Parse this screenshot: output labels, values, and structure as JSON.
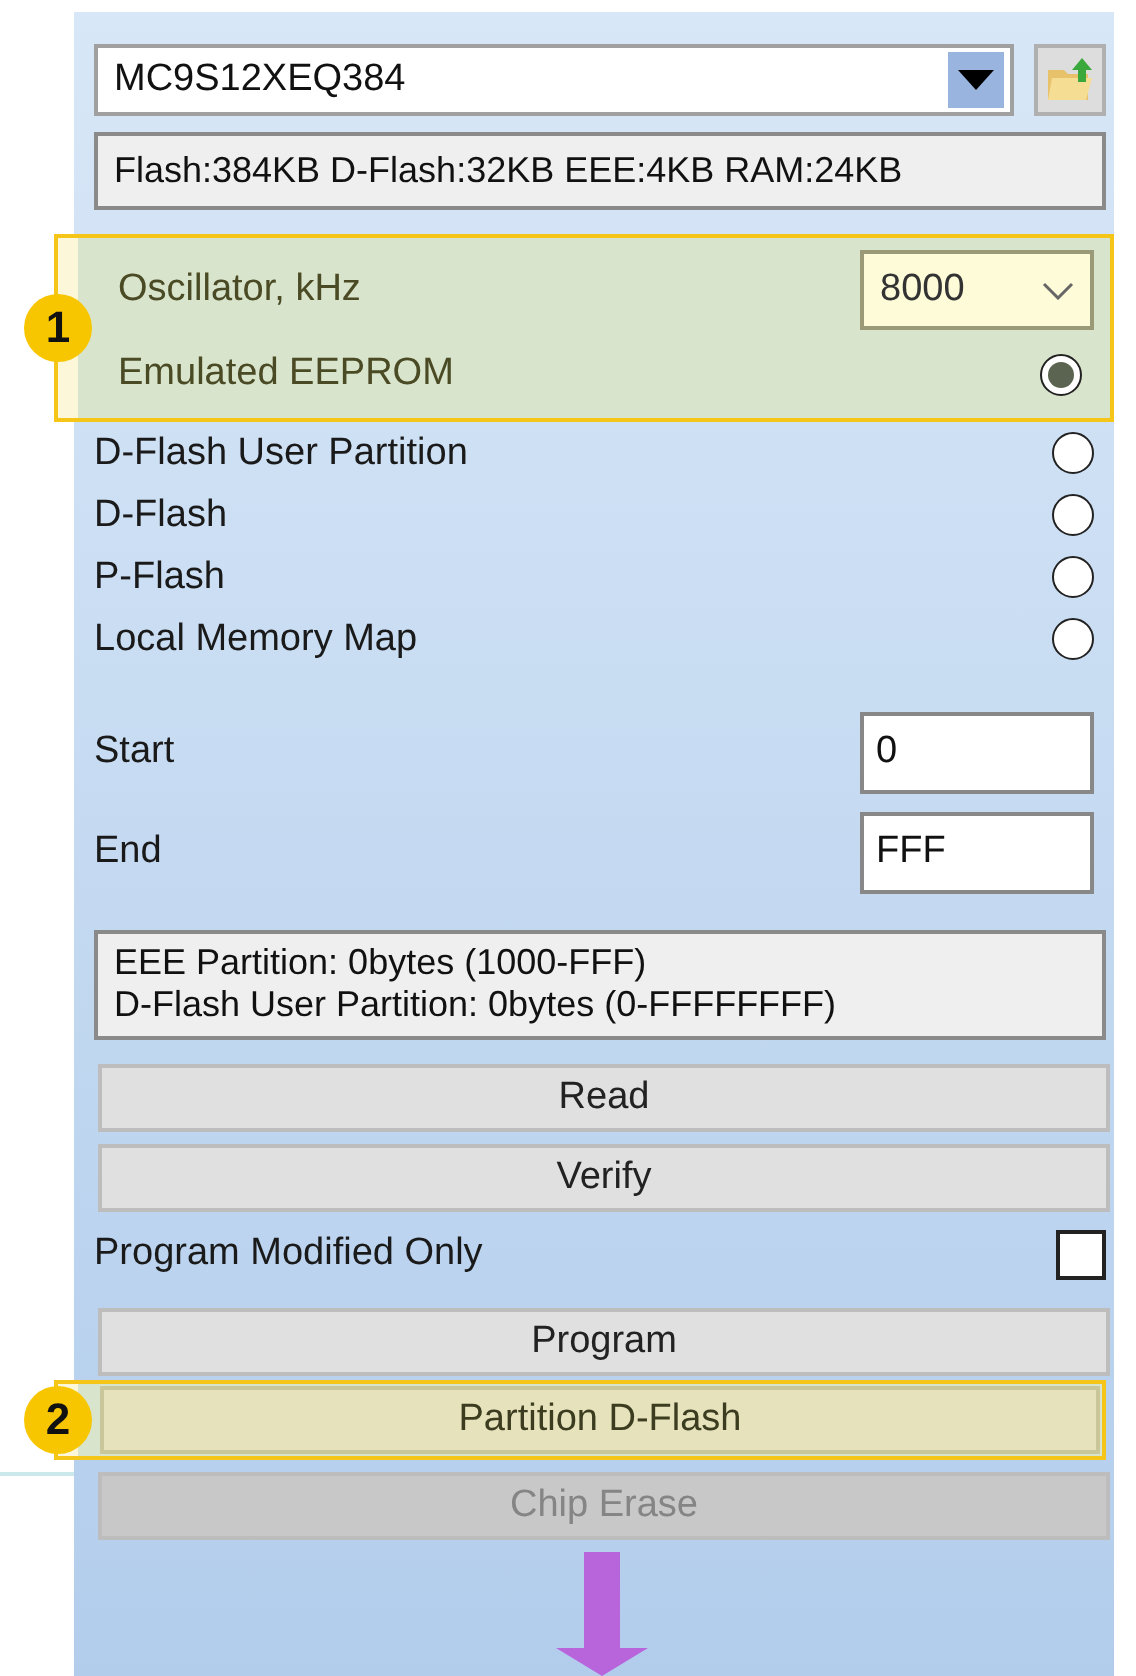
{
  "device": {
    "value": "MC9S12XEQ384"
  },
  "device_info": "Flash:384KB D-Flash:32KB EEE:4KB RAM:24KB",
  "highlight": {
    "badge": "1"
  },
  "oscillator": {
    "label": "Oscillator, kHz",
    "value": "8000"
  },
  "memory_options": [
    {
      "label": "Emulated EEPROM",
      "selected": true
    },
    {
      "label": "D-Flash User Partition",
      "selected": false
    },
    {
      "label": "D-Flash",
      "selected": false
    },
    {
      "label": "P-Flash",
      "selected": false
    },
    {
      "label": "Local Memory Map",
      "selected": false
    }
  ],
  "range": [
    {
      "label": "Start",
      "value": "0"
    },
    {
      "label": "End",
      "value": "FFF"
    }
  ],
  "partition_info": [
    "EEE Partition: 0bytes (1000-FFF)",
    "D-Flash User Partition: 0bytes (0-FFFFFFFF)"
  ],
  "actions": [
    {
      "kind": "button",
      "label": "Read",
      "disabled": false
    },
    {
      "kind": "button",
      "label": "Verify",
      "disabled": false
    },
    {
      "kind": "checkbox",
      "label": "Program Modified Only",
      "checked": false
    },
    {
      "kind": "button",
      "label": "Program",
      "disabled": false
    },
    {
      "kind": "button",
      "label": "Partition D-Flash",
      "disabled": false,
      "badge": "2"
    },
    {
      "kind": "button",
      "label": "Chip Erase",
      "disabled": true
    }
  ]
}
